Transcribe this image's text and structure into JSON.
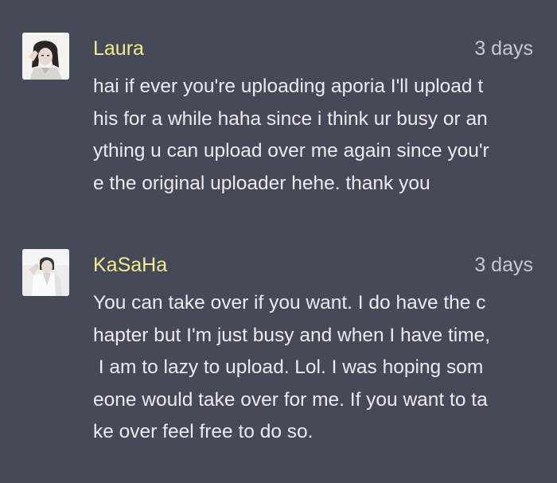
{
  "comments": [
    {
      "username": "Laura",
      "timestamp": "3 days",
      "avatar_icon": "user-avatar-photo",
      "lines": [
        "hai if ever you're uploading aporia I'll upload t",
        "his for a while haha since i think ur busy or an",
        "ything u can upload over me again since you'r",
        "e the original uploader hehe. thank you"
      ]
    },
    {
      "username": "KaSaHa",
      "timestamp": "3 days",
      "avatar_icon": "user-avatar-photo",
      "lines": [
        "You can take over if you want. I do have the c",
        "hapter but I'm just busy and when I have time,",
        " I am to lazy to upload. Lol. I was hoping som",
        "eone would take over for me. If you want to ta",
        "ke over feel free to do so."
      ]
    }
  ],
  "colors": {
    "background": "#464a58",
    "username": "#f2ec8f",
    "timestamp": "#c8c9cf",
    "text": "#ebebef"
  }
}
